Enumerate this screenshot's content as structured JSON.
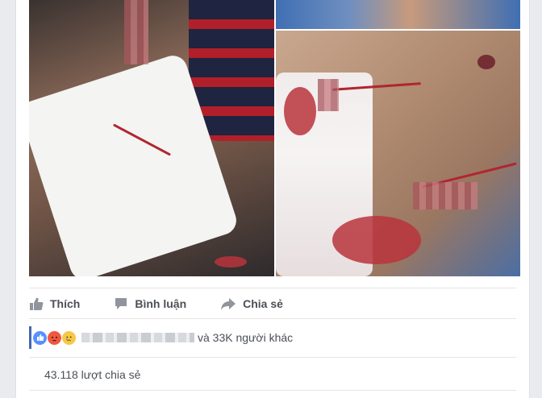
{
  "post": {
    "actions": {
      "like_label": "Thích",
      "comment_label": "Bình luận",
      "share_label": "Chia sẻ"
    },
    "reactions": {
      "icons": [
        "like-icon",
        "angry-icon",
        "sad-icon"
      ],
      "others_text": "và 33K người khác"
    },
    "shares_text": "43.118 lượt chia sẻ"
  },
  "colors": {
    "action_text": "#4b4f56",
    "like_blue": "#5890ff",
    "angry_red": "#f0573f",
    "sad_yellow": "#f7c846",
    "accent": "#4267b2"
  }
}
